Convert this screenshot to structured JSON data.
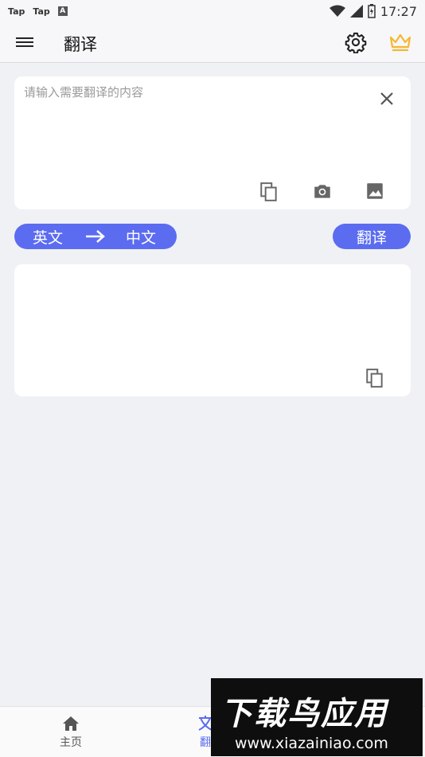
{
  "status_bar": {
    "left_items": [
      "Tap",
      "Tap",
      "A"
    ],
    "time": "17:27"
  },
  "app_bar": {
    "title": "翻译",
    "icons": [
      "menu-icon",
      "gear-icon",
      "crown-icon"
    ]
  },
  "input": {
    "placeholder": "请输入需要翻译的内容",
    "icons": [
      "close-icon",
      "paste-icon",
      "camera-icon",
      "image-icon"
    ]
  },
  "language": {
    "source": "英文",
    "target": "中文"
  },
  "translate_button": "翻译",
  "result": {
    "icons": [
      "copy-icon"
    ]
  },
  "bottom_nav": {
    "items": [
      {
        "label": "主页",
        "icon": "home-icon"
      },
      {
        "label": "翻",
        "icon": "translate-icon"
      }
    ]
  },
  "watermark": {
    "logo": "下载鸟应用",
    "url": "www.xiazainiao.com"
  },
  "colors": {
    "accent": "#5b6cf0",
    "crown": "#f5b82e",
    "background": "#f0f1f5"
  }
}
